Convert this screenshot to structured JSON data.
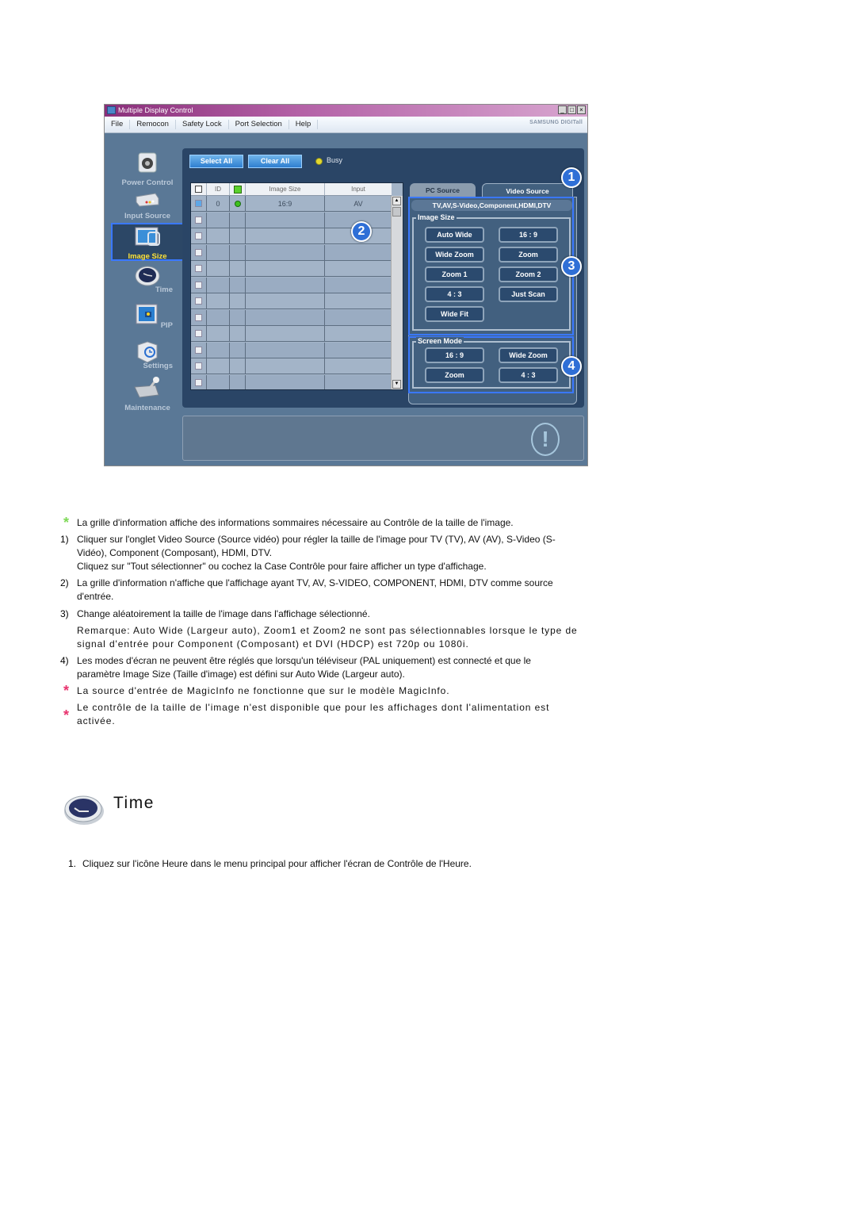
{
  "window": {
    "title": "Multiple Display Control",
    "controls": [
      "_",
      "□",
      "×"
    ],
    "menu": [
      "File",
      "Remocon",
      "Safety Lock",
      "Port Selection",
      "Help"
    ],
    "brand": "SAMSUNG DIGITall"
  },
  "sidebar": {
    "items": [
      {
        "label": "Power Control",
        "icon": "power-control-icon",
        "selected": false
      },
      {
        "label": "Input Source",
        "icon": "input-source-icon",
        "selected": false
      },
      {
        "label": "Image Size",
        "icon": "image-size-icon",
        "selected": true
      },
      {
        "label": "Time",
        "icon": "clock-icon",
        "selected": false
      },
      {
        "label": "PIP",
        "icon": "pip-icon",
        "selected": false
      },
      {
        "label": "Settings",
        "icon": "settings-icon",
        "selected": false
      },
      {
        "label": "Maintenance",
        "icon": "maintenance-icon",
        "selected": false
      }
    ]
  },
  "toolbar": {
    "select_all": "Select All",
    "clear_all": "Clear All",
    "busy_label": "Busy"
  },
  "grid": {
    "columns": [
      "",
      "ID",
      "",
      "Image Size",
      "Input"
    ],
    "rows": [
      {
        "checked": true,
        "id": "0",
        "power": "on",
        "image_size": "16:9",
        "input": "AV"
      },
      {
        "checked": false,
        "id": "",
        "power": "",
        "image_size": "",
        "input": ""
      },
      {
        "checked": false,
        "id": "",
        "power": "",
        "image_size": "",
        "input": ""
      },
      {
        "checked": false,
        "id": "",
        "power": "",
        "image_size": "",
        "input": ""
      },
      {
        "checked": false,
        "id": "",
        "power": "",
        "image_size": "",
        "input": ""
      },
      {
        "checked": false,
        "id": "",
        "power": "",
        "image_size": "",
        "input": ""
      },
      {
        "checked": false,
        "id": "",
        "power": "",
        "image_size": "",
        "input": ""
      },
      {
        "checked": false,
        "id": "",
        "power": "",
        "image_size": "",
        "input": ""
      },
      {
        "checked": false,
        "id": "",
        "power": "",
        "image_size": "",
        "input": ""
      },
      {
        "checked": false,
        "id": "",
        "power": "",
        "image_size": "",
        "input": ""
      },
      {
        "checked": false,
        "id": "",
        "power": "",
        "image_size": "",
        "input": ""
      },
      {
        "checked": false,
        "id": "",
        "power": "",
        "image_size": "",
        "input": ""
      }
    ]
  },
  "tabs": {
    "pc_source": "PC Source",
    "video_source": "Video Source",
    "active": "Video Source",
    "source_banner": "TV,AV,S-Video,Component,HDMI,DTV"
  },
  "image_size": {
    "label": "Image Size",
    "buttons": [
      "Auto Wide",
      "16 : 9",
      "Wide Zoom",
      "Zoom",
      "Zoom 1",
      "Zoom 2",
      "4 : 3",
      "Just Scan",
      "Wide Fit"
    ]
  },
  "screen_mode": {
    "label": "Screen Mode",
    "buttons": [
      "16 : 9",
      "Wide Zoom",
      "Zoom",
      "4 : 3"
    ]
  },
  "callouts": [
    "1",
    "2",
    "3",
    "4"
  ],
  "doc": {
    "note_grid": "La grille d'information affiche des informations sommaires nécessaire au Contrôle de la taille de l'image.",
    "items": [
      {
        "num": "1)",
        "lines": [
          "Cliquer sur l'onglet Video Source (Source vidéo) pour régler la taille de l'image pour TV (TV), AV (AV), S-Video (S-",
          "Vidéo), Component (Composant), HDMI, DTV.",
          "Cliquez sur \"Tout sélectionner\" ou cochez la Case Contrôle pour faire afficher un type d'affichage."
        ]
      },
      {
        "num": "2)",
        "lines": [
          "La grille d'information n'affiche que l'affichage ayant TV, AV, S-VIDEO, COMPONENT, HDMI, DTV comme source",
          "d'entrée."
        ]
      },
      {
        "num": "3)",
        "lines": [
          "Change aléatoirement la taille de l'image dans l'affichage sélectionné."
        ]
      },
      {
        "num": "",
        "lines": [
          "Remarque: Auto Wide (Largeur auto), Zoom1 et Zoom2 ne sont pas sélectionnables lorsque le type de",
          "signal d'entrée pour Component (Composant) et DVI (HDCP) est 720p ou 1080i."
        ]
      },
      {
        "num": "4)",
        "lines": [
          "Les modes d'écran ne peuvent être réglés que lorsqu'un téléviseur (PAL uniquement) est connecté et que le",
          "paramètre Image Size (Taille d'image) est défini sur Auto Wide (Largeur auto)."
        ]
      }
    ],
    "note_magicinfo": "La source d'entrée de MagicInfo ne fonctionne que sur le modèle MagicInfo.",
    "note_power": [
      "Le contrôle de la taille de l'image n'est disponible que pour les affichages dont l'alimentation est",
      "activée."
    ],
    "section_title": "Time",
    "step1_num": "1.",
    "step1": "Cliquez sur l'icône Heure dans le menu principal pour afficher l'écran de Contrôle de l'Heure."
  },
  "colors": {
    "note_green": "#7ed957",
    "note_pink": "#e8336e",
    "selection_blue": "#3a78ff",
    "badge_blue": "#2f6fd6"
  }
}
